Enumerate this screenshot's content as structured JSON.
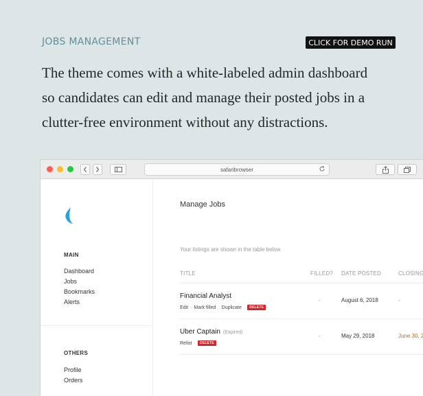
{
  "header": {
    "section_title": "JOBS MANAGEMENT",
    "demo_button": "CLICK FOR DEMO RUN",
    "description_lines": [
      "The theme comes with a white-labeled admin dashboard",
      "so candidates can edit and manage their posted jobs in a",
      "clutter-free environment without any distractions."
    ]
  },
  "browser": {
    "address": "safaribrowser"
  },
  "sidebar": {
    "groups": [
      {
        "title": "MAIN",
        "items": [
          "Dashboard",
          "Jobs",
          "Bookmarks",
          "Alerts"
        ]
      },
      {
        "title": "OTHERS",
        "items": [
          "Profile",
          "Orders"
        ]
      }
    ]
  },
  "main": {
    "title": "Manage Jobs",
    "intro": "Your listings are shown in the table below.",
    "columns": [
      "TITLE",
      "FILLED?",
      "DATE POSTED",
      "CLOSING"
    ],
    "rows": [
      {
        "title": "Financial Analyst",
        "status": "",
        "actions": [
          "Edit",
          "Mark filled",
          "Duplicate"
        ],
        "delete": "DELETE",
        "filled": "-",
        "date_posted": "August 6, 2018",
        "closing": "-"
      },
      {
        "title": "Uber Captain",
        "status": "(Expired)",
        "actions": [
          "Relist"
        ],
        "delete": "DELETE",
        "filled": "-",
        "date_posted": "May 29, 2018",
        "closing": "June 30, 2"
      }
    ]
  },
  "colors": {
    "background": "#dde5e6",
    "section_title": "#5f9097",
    "delete_badge": "#d2262a",
    "logo": "#2aa2d6"
  }
}
